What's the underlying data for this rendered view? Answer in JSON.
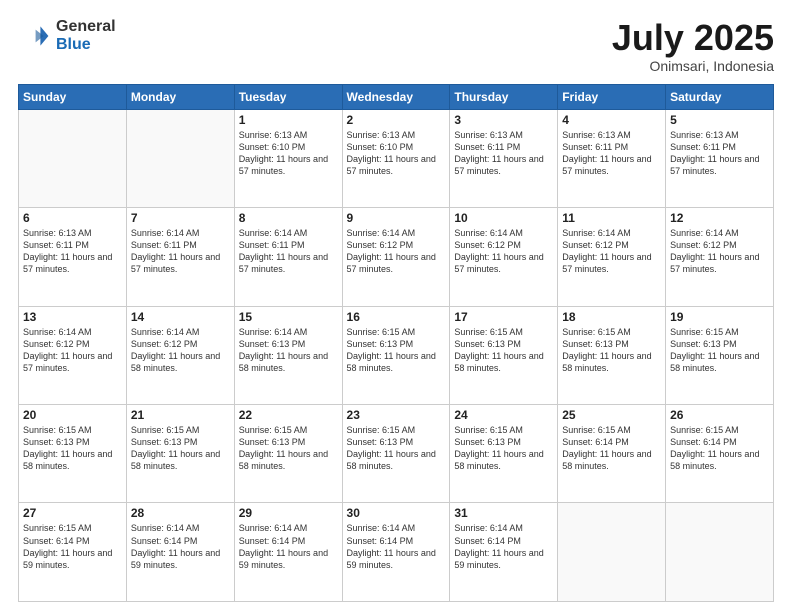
{
  "logo": {
    "general": "General",
    "blue": "Blue"
  },
  "header": {
    "month": "July 2025",
    "location": "Onimsari, Indonesia"
  },
  "weekdays": [
    "Sunday",
    "Monday",
    "Tuesday",
    "Wednesday",
    "Thursday",
    "Friday",
    "Saturday"
  ],
  "weeks": [
    [
      {
        "day": "",
        "info": ""
      },
      {
        "day": "",
        "info": ""
      },
      {
        "day": "1",
        "info": "Sunrise: 6:13 AM\nSunset: 6:10 PM\nDaylight: 11 hours and 57 minutes."
      },
      {
        "day": "2",
        "info": "Sunrise: 6:13 AM\nSunset: 6:10 PM\nDaylight: 11 hours and 57 minutes."
      },
      {
        "day": "3",
        "info": "Sunrise: 6:13 AM\nSunset: 6:11 PM\nDaylight: 11 hours and 57 minutes."
      },
      {
        "day": "4",
        "info": "Sunrise: 6:13 AM\nSunset: 6:11 PM\nDaylight: 11 hours and 57 minutes."
      },
      {
        "day": "5",
        "info": "Sunrise: 6:13 AM\nSunset: 6:11 PM\nDaylight: 11 hours and 57 minutes."
      }
    ],
    [
      {
        "day": "6",
        "info": "Sunrise: 6:13 AM\nSunset: 6:11 PM\nDaylight: 11 hours and 57 minutes."
      },
      {
        "day": "7",
        "info": "Sunrise: 6:14 AM\nSunset: 6:11 PM\nDaylight: 11 hours and 57 minutes."
      },
      {
        "day": "8",
        "info": "Sunrise: 6:14 AM\nSunset: 6:11 PM\nDaylight: 11 hours and 57 minutes."
      },
      {
        "day": "9",
        "info": "Sunrise: 6:14 AM\nSunset: 6:12 PM\nDaylight: 11 hours and 57 minutes."
      },
      {
        "day": "10",
        "info": "Sunrise: 6:14 AM\nSunset: 6:12 PM\nDaylight: 11 hours and 57 minutes."
      },
      {
        "day": "11",
        "info": "Sunrise: 6:14 AM\nSunset: 6:12 PM\nDaylight: 11 hours and 57 minutes."
      },
      {
        "day": "12",
        "info": "Sunrise: 6:14 AM\nSunset: 6:12 PM\nDaylight: 11 hours and 57 minutes."
      }
    ],
    [
      {
        "day": "13",
        "info": "Sunrise: 6:14 AM\nSunset: 6:12 PM\nDaylight: 11 hours and 57 minutes."
      },
      {
        "day": "14",
        "info": "Sunrise: 6:14 AM\nSunset: 6:12 PM\nDaylight: 11 hours and 58 minutes."
      },
      {
        "day": "15",
        "info": "Sunrise: 6:14 AM\nSunset: 6:13 PM\nDaylight: 11 hours and 58 minutes."
      },
      {
        "day": "16",
        "info": "Sunrise: 6:15 AM\nSunset: 6:13 PM\nDaylight: 11 hours and 58 minutes."
      },
      {
        "day": "17",
        "info": "Sunrise: 6:15 AM\nSunset: 6:13 PM\nDaylight: 11 hours and 58 minutes."
      },
      {
        "day": "18",
        "info": "Sunrise: 6:15 AM\nSunset: 6:13 PM\nDaylight: 11 hours and 58 minutes."
      },
      {
        "day": "19",
        "info": "Sunrise: 6:15 AM\nSunset: 6:13 PM\nDaylight: 11 hours and 58 minutes."
      }
    ],
    [
      {
        "day": "20",
        "info": "Sunrise: 6:15 AM\nSunset: 6:13 PM\nDaylight: 11 hours and 58 minutes."
      },
      {
        "day": "21",
        "info": "Sunrise: 6:15 AM\nSunset: 6:13 PM\nDaylight: 11 hours and 58 minutes."
      },
      {
        "day": "22",
        "info": "Sunrise: 6:15 AM\nSunset: 6:13 PM\nDaylight: 11 hours and 58 minutes."
      },
      {
        "day": "23",
        "info": "Sunrise: 6:15 AM\nSunset: 6:13 PM\nDaylight: 11 hours and 58 minutes."
      },
      {
        "day": "24",
        "info": "Sunrise: 6:15 AM\nSunset: 6:13 PM\nDaylight: 11 hours and 58 minutes."
      },
      {
        "day": "25",
        "info": "Sunrise: 6:15 AM\nSunset: 6:14 PM\nDaylight: 11 hours and 58 minutes."
      },
      {
        "day": "26",
        "info": "Sunrise: 6:15 AM\nSunset: 6:14 PM\nDaylight: 11 hours and 58 minutes."
      }
    ],
    [
      {
        "day": "27",
        "info": "Sunrise: 6:15 AM\nSunset: 6:14 PM\nDaylight: 11 hours and 59 minutes."
      },
      {
        "day": "28",
        "info": "Sunrise: 6:14 AM\nSunset: 6:14 PM\nDaylight: 11 hours and 59 minutes."
      },
      {
        "day": "29",
        "info": "Sunrise: 6:14 AM\nSunset: 6:14 PM\nDaylight: 11 hours and 59 minutes."
      },
      {
        "day": "30",
        "info": "Sunrise: 6:14 AM\nSunset: 6:14 PM\nDaylight: 11 hours and 59 minutes."
      },
      {
        "day": "31",
        "info": "Sunrise: 6:14 AM\nSunset: 6:14 PM\nDaylight: 11 hours and 59 minutes."
      },
      {
        "day": "",
        "info": ""
      },
      {
        "day": "",
        "info": ""
      }
    ]
  ]
}
